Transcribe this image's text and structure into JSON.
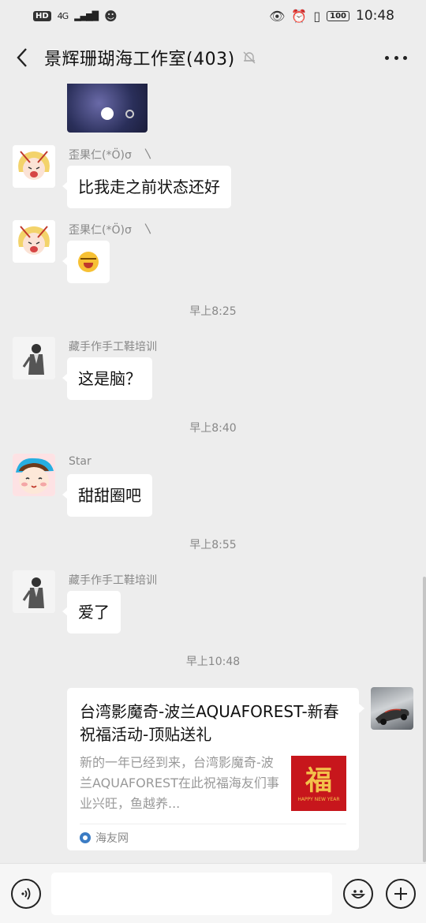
{
  "status_bar": {
    "network": "HD",
    "signal": "4G",
    "battery": "100",
    "time": "10:48"
  },
  "header": {
    "title": "景辉珊瑚海工作室(403)"
  },
  "messages": [
    {
      "sender": "歪果仁(*Ö)σ　〵",
      "text": "比我走之前状态还好"
    },
    {
      "sender": "歪果仁(*Ö)σ　〵",
      "emoji": "laughing-crying-face"
    },
    {
      "sender": "藏手作手工鞋培训",
      "text": "这是脑？"
    },
    {
      "sender": "Star",
      "text": "甜甜圈吧"
    },
    {
      "sender": "藏手作手工鞋培训",
      "text": "爱了"
    }
  ],
  "timestamps": [
    "早上8:25",
    "早上8:40",
    "早上8:55",
    "早上10:48"
  ],
  "link_card": {
    "title": "台湾影魔奇-波兰AQUAFOREST-新春祝福活动-顶贴送礼",
    "description": "新的一年已经到来，台湾影魔奇-波兰AQUAFOREST在此祝福海友们事业兴旺，鱼越养...",
    "thumb_text": "福",
    "thumb_sub": "HAPPY NEW YEAR",
    "source": "海友网"
  },
  "input": {
    "placeholder": ""
  },
  "colors": {
    "background": "#ededed",
    "bubble": "#ffffff",
    "meta_text": "#888888"
  }
}
